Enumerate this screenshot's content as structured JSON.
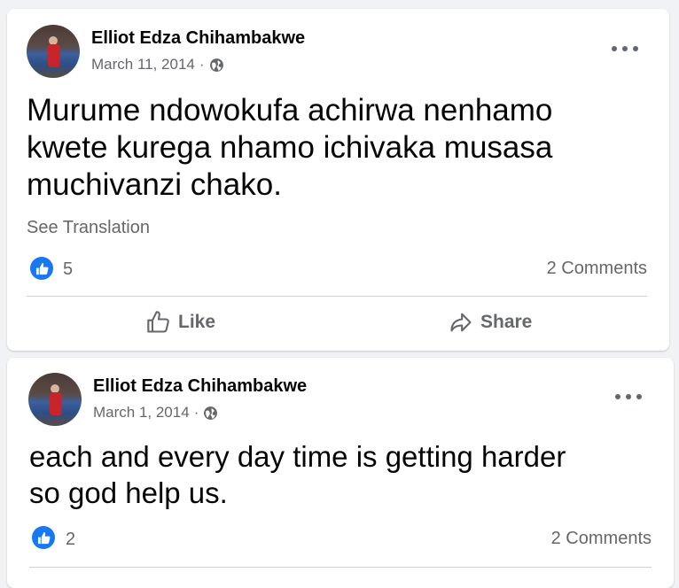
{
  "posts": [
    {
      "author": "Elliot Edza Chihambakwe",
      "date": "March 11, 2014",
      "separator": "·",
      "text_lines": [
        "Murume ndowokufa achirwa nenhamo",
        "kwete kurega nhamo ichivaka musasa",
        "muchivanzi chako."
      ],
      "see_translation": "See Translation",
      "likes": "5",
      "comments": "2 Comments",
      "like_label": "Like",
      "share_label": "Share"
    },
    {
      "author": "Elliot Edza Chihambakwe",
      "date": "March 1, 2014",
      "separator": "·",
      "text_lines": [
        "each and every day time is getting harder",
        "so god help us."
      ],
      "likes": "2",
      "comments": "2 Comments"
    }
  ],
  "icons": {
    "privacy": "globe-icon",
    "more": "more-options-icon",
    "reaction": "like-reaction-icon",
    "like_action": "thumbs-up-icon",
    "share_action": "share-arrow-icon"
  },
  "colors": {
    "background": "#f0f2f5",
    "card": "#ffffff",
    "accent": "#1877f2",
    "secondary_text": "#65676b"
  }
}
